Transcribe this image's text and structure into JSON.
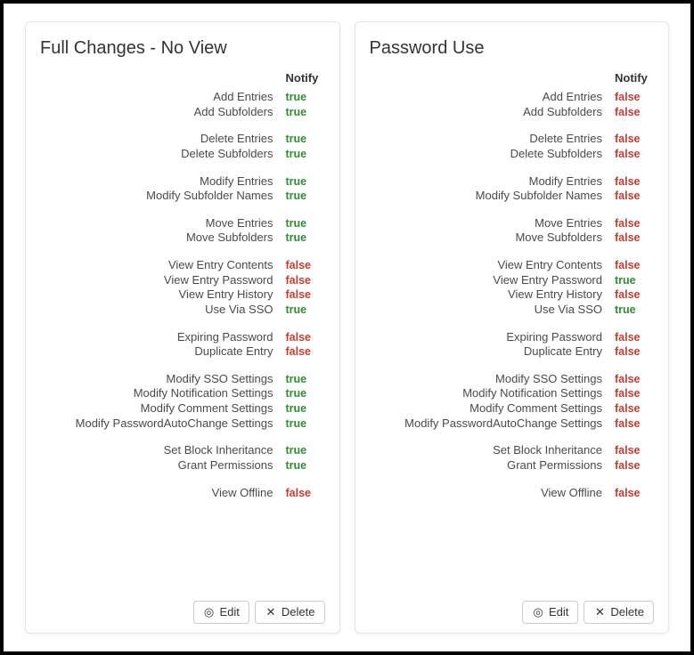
{
  "common": {
    "notify_header": "Notify",
    "edit_label": "Edit",
    "delete_label": "Delete"
  },
  "cards": [
    {
      "title": "Full Changes - No View",
      "groups": [
        [
          {
            "label": "Add Entries",
            "notify": "true"
          },
          {
            "label": "Add Subfolders",
            "notify": "true"
          }
        ],
        [
          {
            "label": "Delete Entries",
            "notify": "true"
          },
          {
            "label": "Delete Subfolders",
            "notify": "true"
          }
        ],
        [
          {
            "label": "Modify Entries",
            "notify": "true"
          },
          {
            "label": "Modify Subfolder Names",
            "notify": "true"
          }
        ],
        [
          {
            "label": "Move Entries",
            "notify": "true"
          },
          {
            "label": "Move Subfolders",
            "notify": "true"
          }
        ],
        [
          {
            "label": "View Entry Contents",
            "notify": "false"
          },
          {
            "label": "View Entry Password",
            "notify": "false"
          },
          {
            "label": "View Entry History",
            "notify": "false"
          },
          {
            "label": "Use Via SSO",
            "notify": "true"
          }
        ],
        [
          {
            "label": "Expiring Password",
            "notify": "false"
          },
          {
            "label": "Duplicate Entry",
            "notify": "false"
          }
        ],
        [
          {
            "label": "Modify SSO Settings",
            "notify": "true"
          },
          {
            "label": "Modify Notification Settings",
            "notify": "true"
          },
          {
            "label": "Modify Comment Settings",
            "notify": "true"
          },
          {
            "label": "Modify PasswordAutoChange Settings",
            "notify": "true"
          }
        ],
        [
          {
            "label": "Set Block Inheritance",
            "notify": "true"
          },
          {
            "label": "Grant Permissions",
            "notify": "true"
          }
        ],
        [
          {
            "label": "View Offline",
            "notify": "false"
          }
        ]
      ]
    },
    {
      "title": "Password Use",
      "groups": [
        [
          {
            "label": "Add Entries",
            "notify": "false"
          },
          {
            "label": "Add Subfolders",
            "notify": "false"
          }
        ],
        [
          {
            "label": "Delete Entries",
            "notify": "false"
          },
          {
            "label": "Delete Subfolders",
            "notify": "false"
          }
        ],
        [
          {
            "label": "Modify Entries",
            "notify": "false"
          },
          {
            "label": "Modify Subfolder Names",
            "notify": "false"
          }
        ],
        [
          {
            "label": "Move Entries",
            "notify": "false"
          },
          {
            "label": "Move Subfolders",
            "notify": "false"
          }
        ],
        [
          {
            "label": "View Entry Contents",
            "notify": "false"
          },
          {
            "label": "View Entry Password",
            "notify": "true"
          },
          {
            "label": "View Entry History",
            "notify": "false"
          },
          {
            "label": "Use Via SSO",
            "notify": "true"
          }
        ],
        [
          {
            "label": "Expiring Password",
            "notify": "false"
          },
          {
            "label": "Duplicate Entry",
            "notify": "false"
          }
        ],
        [
          {
            "label": "Modify SSO Settings",
            "notify": "false"
          },
          {
            "label": "Modify Notification Settings",
            "notify": "false"
          },
          {
            "label": "Modify Comment Settings",
            "notify": "false"
          },
          {
            "label": "Modify PasswordAutoChange Settings",
            "notify": "false"
          }
        ],
        [
          {
            "label": "Set Block Inheritance",
            "notify": "false"
          },
          {
            "label": "Grant Permissions",
            "notify": "false"
          }
        ],
        [
          {
            "label": "View Offline",
            "notify": "false"
          }
        ]
      ]
    }
  ]
}
